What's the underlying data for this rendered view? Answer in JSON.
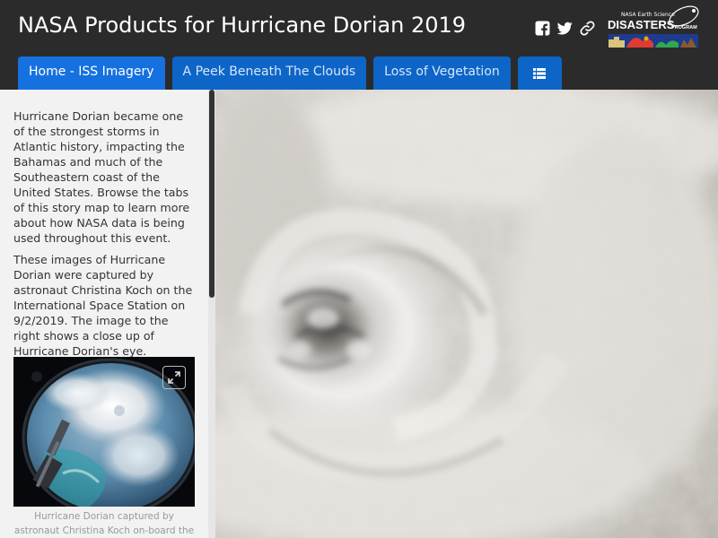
{
  "header": {
    "title": "NASA Products for Hurricane Dorian 2019",
    "social_icons": [
      "facebook-icon",
      "twitter-icon",
      "link-icon"
    ],
    "logo": {
      "small_text": "NASA Earth Science",
      "big_text": "DISASTERS",
      "program_text": "PROGRAM"
    }
  },
  "tabs": [
    {
      "label": "Home - ISS Imagery",
      "active": true
    },
    {
      "label": "A Peek Beneath The Clouds",
      "active": false
    },
    {
      "label": "Loss of Vegetation",
      "active": false
    },
    {
      "icon": "list-icon",
      "active": false
    }
  ],
  "side_panel": {
    "paragraphs": [
      "Hurricane Dorian became one of the strongest storms in Atlantic history, impacting the Bahamas and much of the Southeastern coast of the United States. Browse the tabs of this story map to learn more about how NASA data is being used throughout this event.",
      "These images of Hurricane Dorian were captured by astronaut Christina Koch on the International Space Station on 9/2/2019. The image to the right shows a close up of Hurricane Dorian's eye."
    ],
    "thumbnail": {
      "expand_icon": "expand-icon"
    },
    "caption": "Hurricane Dorian captured by astronaut Christina Koch on-board the"
  },
  "colors": {
    "header_bg": "#2b2b2b",
    "tab_bg": "#0d65c8",
    "tab_active_bg": "#1671e0",
    "panel_bg": "#f2f2f2",
    "logo_red": "#e03c31"
  }
}
